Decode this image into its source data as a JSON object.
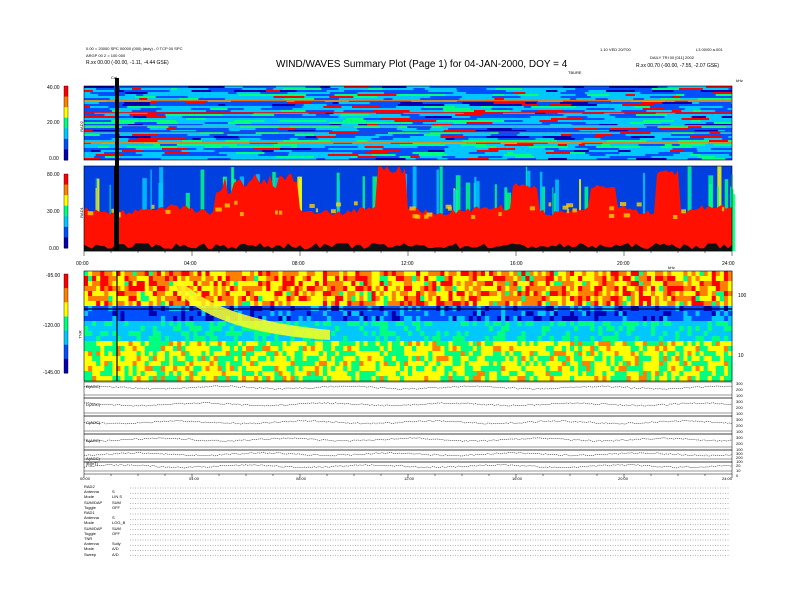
{
  "header": {
    "title": "WIND/WAVES Summary Plot (Page 1) for 04-JAN-2000, DOY = 4",
    "left_line1": "0.00 = 20000 SPC 00000 (000) (duty) - 0 TCP 00 SPC",
    "left_line2": "ARGP 00 2 = 100 000",
    "left_line3": "R.xx  00.00 (-00.00, -1.11, -4.44 GSE)",
    "right_line1": "1.10 VED 20/T00",
    "right_line2": "L3 00/00 a.001",
    "right_line3": "DAILY  TRI 00 [011]  2002",
    "right_line4": "R.xx  00.70 (-00.00, -7.55, -2.07 GSE)",
    "top_axis_label": "TBURE",
    "top_right_unit": "kHz",
    "cal_marker": "Cal"
  },
  "panels": {
    "rad2": {
      "label": "RAD2",
      "ticks": [
        "40.00",
        "20.00",
        "0.00"
      ]
    },
    "rad1": {
      "label": "RAD1",
      "ticks": [
        "80.00",
        "30.00",
        "0.00"
      ]
    },
    "tnr": {
      "label": "TNR",
      "ticks": [
        "-95.00",
        "-120.00",
        "-145.00"
      ],
      "right_ticks": [
        "100",
        "10"
      ],
      "top_right_label": "kHz"
    },
    "time_axis": [
      "00:00",
      "04:00",
      "08:00",
      "12:00",
      "16:00",
      "20:00",
      "24:00"
    ],
    "bottom_time_axis": [
      "00:00",
      "04:00",
      "08:00",
      "12:00",
      "16:00",
      "20:00",
      "24:00"
    ],
    "line_panels": [
      {
        "label": "B(AGC)",
        "right_ticks": [
          "300",
          "200",
          "100"
        ]
      },
      {
        "label": "D(AGC)",
        "right_ticks": [
          "300",
          "200",
          "100"
        ]
      },
      {
        "label": "C(AGC)",
        "right_ticks": [
          "300",
          "200",
          "100"
        ]
      },
      {
        "label": "B(AGC)",
        "right_ticks": [
          "300",
          "200",
          "100"
        ]
      },
      {
        "label": "A(AGC)",
        "right_ticks": [
          "300",
          "200",
          "100"
        ]
      },
      {
        "label": "|B|(nT)",
        "right_ticks": [
          "20",
          "10",
          "0"
        ]
      }
    ]
  },
  "footer": {
    "rows": [
      {
        "key": "RAD2",
        "val": ""
      },
      {
        "key": "Antenna",
        "val": "S"
      },
      {
        "key": "Mode",
        "val": "LIN S"
      },
      {
        "key": "SUM/DAP",
        "val": "SUM"
      },
      {
        "key": "Toggle",
        "val": "OFF"
      },
      {
        "key": "RAD1",
        "val": ""
      },
      {
        "key": "Antenna",
        "val": "S"
      },
      {
        "key": "Mode",
        "val": "LOG_B"
      },
      {
        "key": "SUM/DAP",
        "val": "SUM"
      },
      {
        "key": "Toggle",
        "val": "OFF"
      },
      {
        "key": "TNR",
        "val": ""
      },
      {
        "key": "Antenna",
        "val": "Sully"
      },
      {
        "key": "Mode",
        "val": "A/D"
      },
      {
        "key": "Sweep",
        "val": "A/D"
      }
    ]
  },
  "chart_data": {
    "type": "heatmap",
    "title": "WIND/WAVES Summary Plot (Page 1) for 04-JAN-2000, DOY = 4",
    "xlabel": "",
    "x_range_hours": [
      0,
      24
    ],
    "panels": [
      {
        "name": "RAD2",
        "ylim": [
          0,
          40
        ],
        "colors": [
          "#0000b0",
          "#0050ff",
          "#00c8ff",
          "#00ff80",
          "#ffff00",
          "#ff8000",
          "#ff0000"
        ]
      },
      {
        "name": "RAD1",
        "ylim": [
          0,
          80
        ],
        "colors": [
          "#0000b0",
          "#0050ff",
          "#00c8ff",
          "#00ff80",
          "#ffff00",
          "#ff8000",
          "#ff0000"
        ]
      },
      {
        "name": "TNR",
        "ylim": [
          -145,
          -95
        ],
        "colors": [
          "#0000b0",
          "#0050ff",
          "#00c8ff",
          "#00ff80",
          "#ffff00",
          "#ff8000",
          "#ff0000"
        ]
      }
    ]
  }
}
